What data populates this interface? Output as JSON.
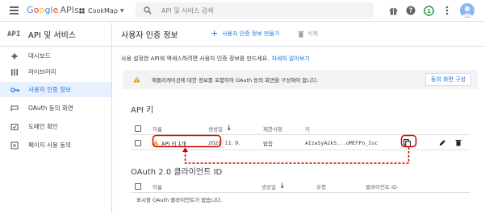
{
  "header": {
    "logo_google": "Google",
    "logo_apis": "APIs",
    "project_name": "CookMap",
    "search_placeholder": "API 및 서비스 검색",
    "avatar_letter": "1"
  },
  "sidebar": {
    "api_badge": "API",
    "title": "API 및 서비스",
    "items": [
      {
        "label": "대시보드",
        "icon": "dashboard-icon"
      },
      {
        "label": "라이브러리",
        "icon": "library-icon"
      },
      {
        "label": "사용자 인증 정보",
        "icon": "key-icon",
        "active": true
      },
      {
        "label": "OAuth 동의 화면",
        "icon": "oauth-consent-icon"
      },
      {
        "label": "도메인 확인",
        "icon": "domain-verification-icon"
      },
      {
        "label": "페이지 사용 동의",
        "icon": "page-usage-agreement-icon"
      }
    ]
  },
  "main": {
    "title": "사용자 인증 정보",
    "create_label": "사용자 인증 정보 만들기",
    "delete_label": "삭제",
    "intro_text": "사용 설정한 API에 액세스하려면 사용자 인증 정보를 만드세요.",
    "intro_link": "자세히 알아보기",
    "banner_text": "애플리케이션에 대한 정보를 포함하여 OAuth 동의 화면을 구성해야 합니다.",
    "banner_button": "동의 화면 구성",
    "api_keys": {
      "title": "API 키",
      "columns": {
        "name": "이름",
        "created": "생성일",
        "restrictions": "제한사항",
        "key": "키"
      },
      "rows": [
        {
          "name": "API 키 1개",
          "created": "2020. 11. 9.",
          "restrictions": "없음",
          "key": "AIzaSyA2kS...oMEFPo_Iuc"
        }
      ]
    },
    "oauth": {
      "title": "OAuth 2.0 클라이언트 ID",
      "columns": {
        "name": "이름",
        "created": "생성일",
        "type": "유형",
        "client_id": "클라이언트 ID"
      },
      "empty_text": "표시할 OAuth 클라이언트가 없습니다."
    }
  },
  "colors": {
    "accent": "#1a73e8",
    "warning": "#f29900",
    "annotation_red": "#d50000",
    "active_bg": "#e8f0fe"
  }
}
